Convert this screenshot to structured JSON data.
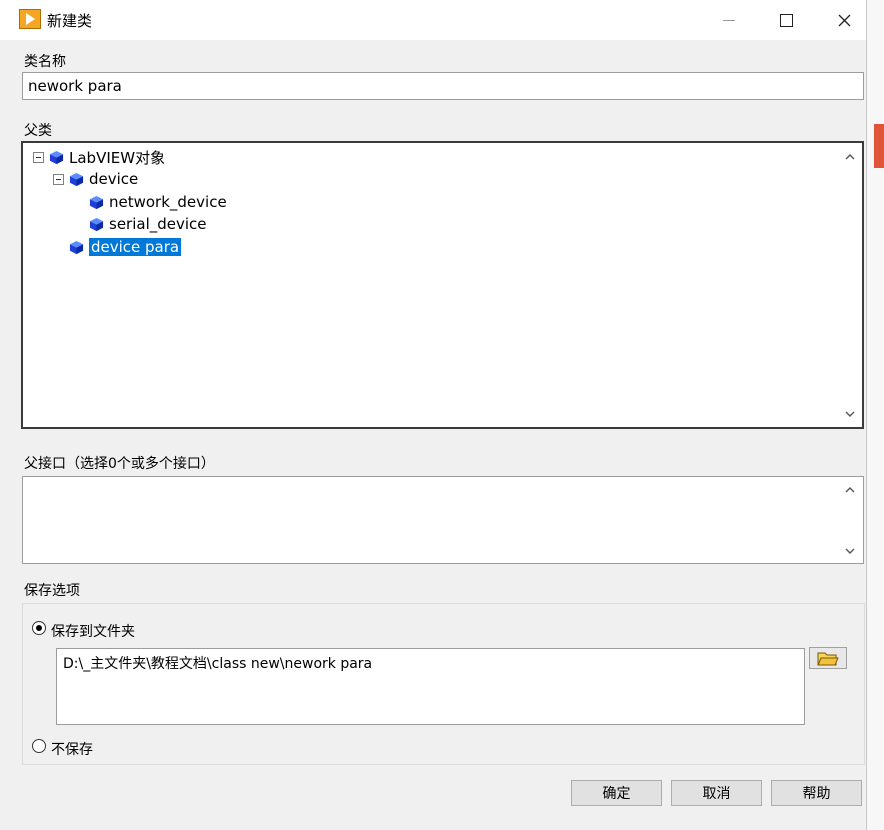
{
  "window": {
    "title": "新建类",
    "controls": [
      "minimize-icon",
      "maximize-icon",
      "close-icon"
    ]
  },
  "class_name": {
    "label": "类名称",
    "value": "nework para"
  },
  "parent": {
    "label": "父类",
    "tree": [
      {
        "label": "LabVIEW对象",
        "level": 0,
        "expanded": true,
        "selected": false
      },
      {
        "label": "device",
        "level": 1,
        "expanded": true,
        "selected": false
      },
      {
        "label": "network_device",
        "level": 2,
        "expanded": false,
        "selected": false
      },
      {
        "label": "serial_device",
        "level": 2,
        "expanded": false,
        "selected": false
      },
      {
        "label": "device para",
        "level": 1,
        "expanded": false,
        "selected": true
      }
    ]
  },
  "interfaces": {
    "label": "父接口（选择0个或多个接口）"
  },
  "save_options": {
    "label": "保存选项",
    "save_to_folder": {
      "label": "保存到文件夹",
      "checked": true
    },
    "path": "D:\\_主文件夹\\教程文档\\class new\\nework para",
    "dont_save": {
      "label": "不保存",
      "checked": false
    }
  },
  "buttons": {
    "ok": "确定",
    "cancel": "取消",
    "help": "帮助"
  },
  "colors": {
    "selection": "#0078d7",
    "cube": "#1f3fd6",
    "accent_icon": "#f5a623"
  }
}
